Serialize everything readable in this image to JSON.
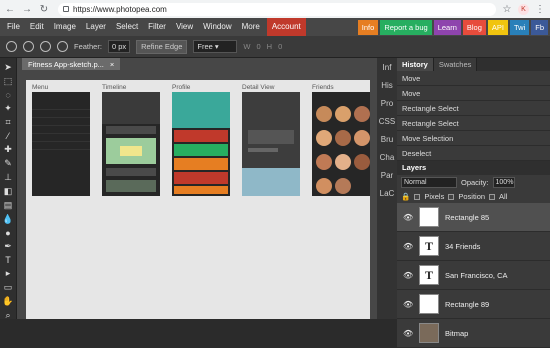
{
  "browser": {
    "url": "https://www.photopea.com",
    "profile_initial": "K"
  },
  "menu": {
    "items": [
      "File",
      "Edit",
      "Image",
      "Layer",
      "Select",
      "Filter",
      "View",
      "Window",
      "More"
    ],
    "account": "Account",
    "right_buttons": [
      {
        "label": "Info",
        "color": "#e67e22"
      },
      {
        "label": "Report a bug",
        "color": "#27ae60"
      },
      {
        "label": "Learn",
        "color": "#8e44ad"
      },
      {
        "label": "Blog",
        "color": "#e74c3c"
      },
      {
        "label": "API",
        "color": "#f1c40f"
      },
      {
        "label": "Twi",
        "color": "#2980b9"
      },
      {
        "label": "Fb",
        "color": "#3b5998"
      }
    ]
  },
  "options": {
    "feather_label": "Feather:",
    "feather_value": "0",
    "feather_unit": "px",
    "refine_edge": "Refine Edge",
    "style_value": "Free",
    "w_label": "W",
    "w_value": "0",
    "h_label": "H",
    "h_value": "0"
  },
  "document": {
    "tab_title": "Fitness App-sketch.p...",
    "close": "×",
    "screens": [
      {
        "label": "Menu"
      },
      {
        "label": "Timeline"
      },
      {
        "label": "Profile"
      },
      {
        "label": "Detail View"
      },
      {
        "label": "Friends"
      }
    ]
  },
  "side_icons": [
    "Inf",
    "His",
    "Pro",
    "CSS",
    "Bru",
    "Cha",
    "Par",
    "LaC"
  ],
  "history": {
    "tabs": [
      "History",
      "Swatches"
    ],
    "items": [
      "Move",
      "Move",
      "Rectangle Select",
      "Rectangle Select",
      "Move Selection",
      "Deselect"
    ]
  },
  "layers": {
    "title": "Layers",
    "blend_mode": "Normal",
    "opacity_label": "Opacity:",
    "opacity_value": "100%",
    "lock_label": "🔒",
    "lock_pixels": "Pixels",
    "lock_position": "Position",
    "lock_all": "All",
    "items": [
      {
        "name": "Rectangle 85",
        "thumb": ""
      },
      {
        "name": "34 Friends",
        "thumb": "T"
      },
      {
        "name": "San Francisco, CA",
        "thumb": "T"
      },
      {
        "name": "Rectangle 89",
        "thumb": ""
      },
      {
        "name": "Bitmap",
        "thumb": ""
      }
    ]
  }
}
